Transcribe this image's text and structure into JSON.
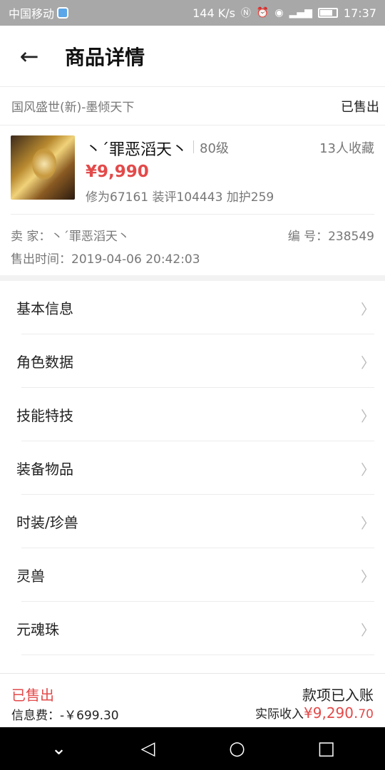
{
  "status_bar": {
    "carrier": "中国移动",
    "speed": "144 K/s",
    "time": "17:37",
    "battery_level": 0.7
  },
  "nav": {
    "back_icon": "←",
    "title": "商品详情"
  },
  "server": {
    "name": "国风盛世(新)-墨倾天下",
    "status": "已售出"
  },
  "item": {
    "name": "丶ˊ罪恶滔天丶",
    "level": "80级",
    "favorites": "13人收藏",
    "price": "¥9,990",
    "stats": "修为67161  装评104443  加护259"
  },
  "seller": {
    "seller": "卖  家：丶ˊ罪恶滔天丶",
    "number": "编  号：238549",
    "sold_time": "售出时间：2019-04-06 20:42:03"
  },
  "menu": [
    {
      "label": "基本信息"
    },
    {
      "label": "角色数据"
    },
    {
      "label": "技能特技"
    },
    {
      "label": "装备物品"
    },
    {
      "label": "时装/珍兽"
    },
    {
      "label": "灵兽"
    },
    {
      "label": "元魂珠"
    }
  ],
  "chevron": "〉",
  "bottom": {
    "sold": "已售出",
    "fee": "信息费：-￥699.30",
    "paid": "款项已入账",
    "income_label": "实际收入",
    "income_amount": "¥9,290.",
    "income_cents": "70"
  },
  "sys_nav": {
    "down": "⌄",
    "back": "◁",
    "home": "○",
    "recent": "□"
  },
  "colors": {
    "accent": "#e34a4a",
    "status_bar": "#a8a8a8"
  }
}
